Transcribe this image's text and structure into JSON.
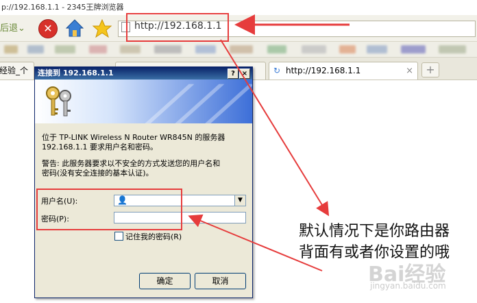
{
  "browser": {
    "title": "p://192.168.1.1 - 2345王牌浏览器",
    "back_label": "后退",
    "address": "http://192.168.1.1",
    "tabs": [
      {
        "label": "经验_个"
      },
      {
        "label": ""
      },
      {
        "label": "http://192.168.1.1"
      }
    ],
    "new_tab": "+",
    "tab_close": "×"
  },
  "dialog": {
    "title": "连接到 192.168.1.1",
    "help_btn": "?",
    "close_btn": "×",
    "message_line1": "位于 TP-LINK Wireless N Router WR845N 的服务器",
    "message_line2": "192.168.1.1 要求用户名和密码。",
    "warning_line1": "警告: 此服务器要求以不安全的方式发送您的用户名和",
    "warning_line2": "密码(没有安全连接的基本认证)。",
    "username_label": "用户名(U):",
    "password_label": "密码(P):",
    "remember_label": "记住我的密码(R)",
    "ok_label": "确定",
    "cancel_label": "取消"
  },
  "annotation": {
    "line1": "默认情况下是你路由器",
    "line2": "背面有或者你设置的哦",
    "color": "#e63c3c"
  },
  "watermark": {
    "brand": "Bai经验",
    "url": "jingyan.baidu.com"
  }
}
